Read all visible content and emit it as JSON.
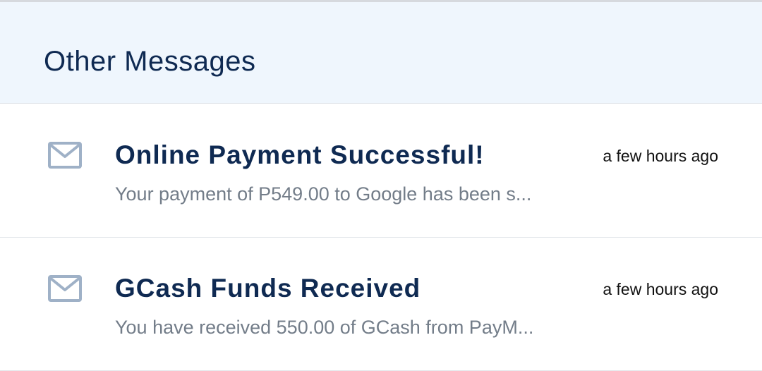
{
  "section": {
    "title": "Other Messages"
  },
  "messages": [
    {
      "icon": "mail-icon",
      "title": "Online Payment Successful!",
      "time": "a few hours ago",
      "preview": "Your payment of P549.00 to Google has been s..."
    },
    {
      "icon": "mail-icon",
      "title": "GCash Funds Received",
      "time": "a few hours ago",
      "preview": "You have received 550.00 of GCash from PayM..."
    }
  ],
  "colors": {
    "header_bg": "#eff6fd",
    "title_text": "#0f2a52",
    "preview_text": "#737d89",
    "icon_color": "#9fb1c7"
  }
}
